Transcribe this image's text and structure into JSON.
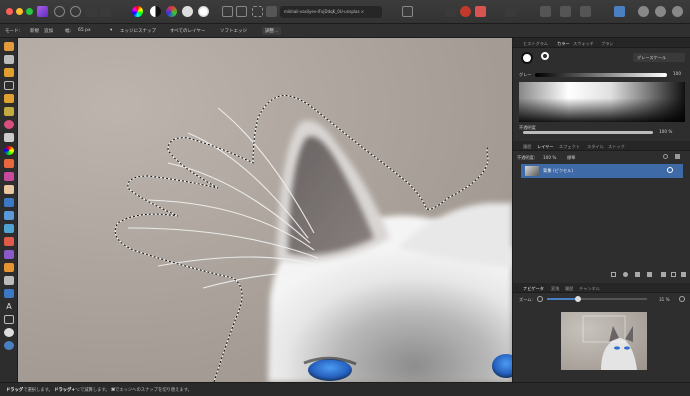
{
  "window": {
    "document_title": "mikhail-vasilyev-IFxjDdqK_0U-unsplas ×"
  },
  "context_toolbar": {
    "mode_label": "モード:",
    "mode_new": "新規",
    "mode_add": "追加",
    "width_label": "幅:",
    "width_value": "65 px",
    "snap_to_edges": "エッジにスナップ",
    "all_layers": "すべてのレイヤー",
    "soft_edges": "ソフトエッジ",
    "refine": "調整..."
  },
  "color_panel": {
    "tabs": [
      "ヒストグラム",
      "カラー",
      "スウォッチ",
      "ブラシ"
    ],
    "active_tab": "カラー",
    "model": "グレースケール",
    "gray_label": "グレー",
    "gray_value": "100",
    "opacity_label": "不透明度",
    "opacity_value": "100 %"
  },
  "layers_panel": {
    "tabs": [
      "履歴",
      "レイヤー",
      "エフェクト",
      "スタイル",
      "ストック"
    ],
    "active_tab": "レイヤー",
    "opacity_label": "不透明度:",
    "opacity_value": "100 %",
    "blend_mode": "標準",
    "layer_name": "背景",
    "layer_type": "(ピクセル)"
  },
  "navigator_panel": {
    "tabs": [
      "ナビゲータ",
      "変換",
      "履歴",
      "チャンネル"
    ],
    "active_tab": "ナビゲータ",
    "zoom_label": "ズーム:",
    "zoom_value": "31 %",
    "zoom_fraction": 0.31
  },
  "status_bar": {
    "drag1": "ドラッグ",
    "text1": "で選択します。",
    "drag2": "ドラッグ+",
    "text2": "で減算します。",
    "text3": "でエッジへのスナップを切り替えます。"
  },
  "colors": {
    "accent": "#4a7fc1",
    "layer_selected": "#3f6aa8",
    "eye_blue": "#2f6fd0"
  }
}
